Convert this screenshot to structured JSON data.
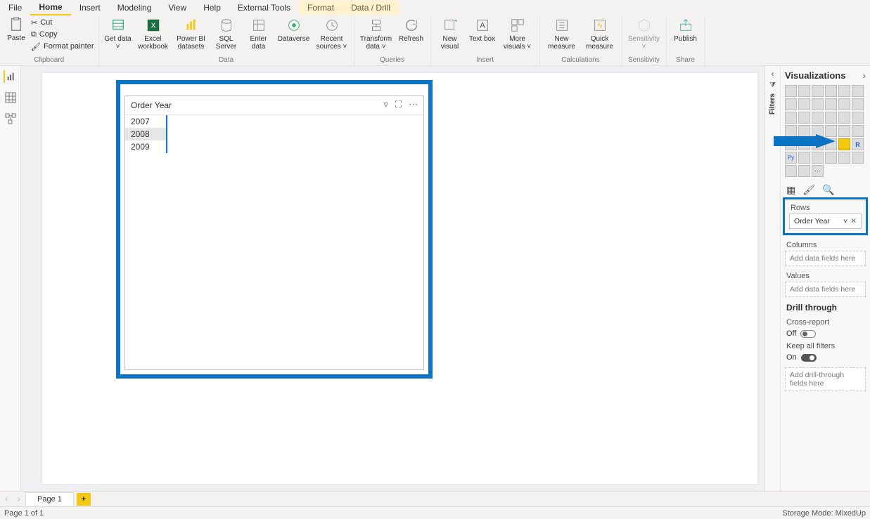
{
  "ribbon_tabs": {
    "file": "File",
    "home": "Home",
    "insert": "Insert",
    "modeling": "Modeling",
    "view": "View",
    "help": "Help",
    "external_tools": "External Tools",
    "format": "Format",
    "data_drill": "Data / Drill"
  },
  "clipboard": {
    "paste": "Paste",
    "cut": "Cut",
    "copy": "Copy",
    "format_painter": "Format painter",
    "group": "Clipboard"
  },
  "data_group": {
    "get_data": "Get data ˅",
    "excel": "Excel workbook",
    "pbi_datasets": "Power BI datasets",
    "sql": "SQL Server",
    "enter": "Enter data",
    "dataverse": "Dataverse",
    "recent": "Recent sources ˅",
    "group": "Data"
  },
  "queries_group": {
    "transform": "Transform data ˅",
    "refresh": "Refresh",
    "group": "Queries"
  },
  "insert_group": {
    "new_visual": "New visual",
    "text_box": "Text box",
    "more_visuals": "More visuals ˅",
    "group": "Insert"
  },
  "calc_group": {
    "new_measure": "New measure",
    "quick_measure": "Quick measure",
    "group": "Calculations"
  },
  "sensitivity_group": {
    "sensitivity": "Sensitivity ˅",
    "group": "Sensitivity"
  },
  "share_group": {
    "publish": "Publish",
    "group": "Share"
  },
  "filters_pane": {
    "title": "Filters"
  },
  "viz_pane": {
    "title": "Visualizations",
    "rows_label": "Rows",
    "rows_field": "Order Year",
    "columns_label": "Columns",
    "values_label": "Values",
    "placeholder": "Add data fields here",
    "drill_header": "Drill through",
    "cross_report": "Cross-report",
    "off": "Off",
    "keep_filters": "Keep all filters",
    "on": "On",
    "drill_placeholder": "Add drill-through fields here"
  },
  "visual": {
    "header": "Order Year",
    "rows": [
      "2007",
      "2008",
      "2009"
    ],
    "selected_index": 1
  },
  "page_bar": {
    "page1": "Page 1",
    "add": "+"
  },
  "status": {
    "left": "Page 1 of 1",
    "right": "Storage Mode: MixedUp"
  },
  "chart_data": {
    "type": "table",
    "title": "Order Year",
    "columns": [
      "Order Year"
    ],
    "rows": [
      [
        "2007"
      ],
      [
        "2008"
      ],
      [
        "2009"
      ]
    ]
  }
}
